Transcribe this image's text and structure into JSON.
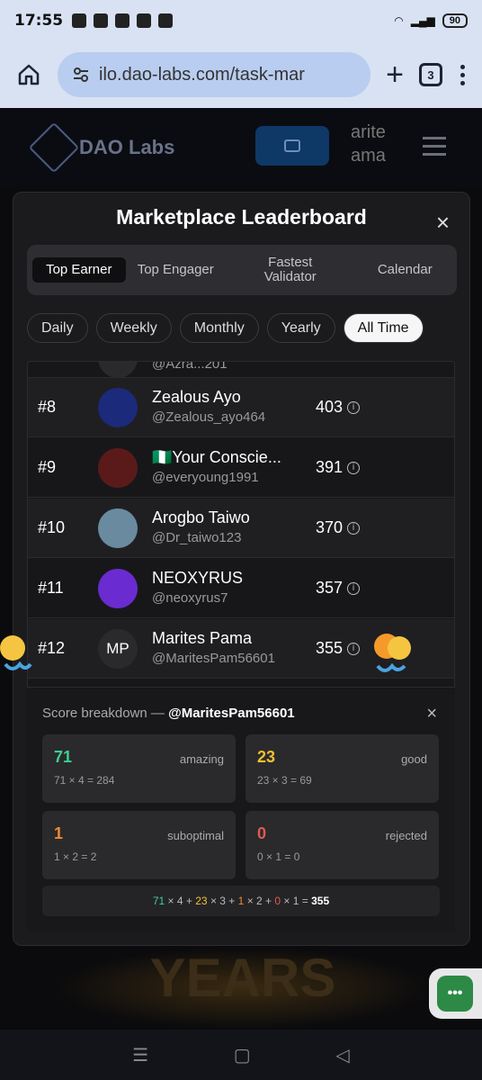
{
  "status_bar": {
    "time": "17:55",
    "battery": "90"
  },
  "browser": {
    "url": "ilo.dao-labs.com/task-mar",
    "tab_count": "3",
    "new_tab": "+"
  },
  "site": {
    "brand": "DAO Labs",
    "user_partial": "arite\nama"
  },
  "modal": {
    "title": "Marketplace Leaderboard",
    "close": "×",
    "tabs": [
      {
        "label": "Top Earner",
        "active": true
      },
      {
        "label": "Top Engager"
      },
      {
        "label": "Fastest Validator"
      },
      {
        "label": "Calendar"
      }
    ],
    "periods": [
      {
        "label": "Daily"
      },
      {
        "label": "Weekly"
      },
      {
        "label": "Monthly"
      },
      {
        "label": "Yearly"
      },
      {
        "label": "All Time",
        "active": true
      }
    ],
    "partial_row_handle": "@Azra...201",
    "rows": [
      {
        "rank": "#8",
        "name": "Zealous Ayo",
        "handle": "@Zealous_ayo464",
        "score": "403",
        "avatar_color": "#1b2a7a"
      },
      {
        "rank": "#9",
        "name": "🇳🇬Your Conscie...",
        "handle": "@everyoung1991",
        "score": "391",
        "avatar_color": "#5a1a1a"
      },
      {
        "rank": "#10",
        "name": "Arogbo Taiwo",
        "handle": "@Dr_taiwo123",
        "score": "370",
        "avatar_color": "#6a8aa0"
      },
      {
        "rank": "#11",
        "name": "NEOXYRUS",
        "handle": "@neoxyrus7",
        "score": "357",
        "avatar_color": "#6a2bd0"
      },
      {
        "rank": "#12",
        "name": "Marites Pama",
        "handle": "@MaritesPam56601",
        "score": "355",
        "avatar_initials": "MP",
        "avatar_color": "#2a2a2d"
      }
    ],
    "breakdown": {
      "title_prefix": "Score breakdown —",
      "handle": "@MaritesPam56601",
      "close": "×",
      "cards": [
        {
          "num": "71",
          "label": "amazing",
          "calc": "71 × 4 = 284",
          "color": "#3ecf8e"
        },
        {
          "num": "23",
          "label": "good",
          "calc": "23 × 3 = 69",
          "color": "#f0c030"
        },
        {
          "num": "1",
          "label": "suboptimal",
          "calc": "1 × 2 = 2",
          "color": "#f08a30"
        },
        {
          "num": "0",
          "label": "rejected",
          "calc": "0 × 1 = 0",
          "color": "#e05a50"
        }
      ],
      "formula": {
        "a": "71",
        "a_mult": "× 4 +",
        "b": "23",
        "b_mult": "× 3 +",
        "c": "1",
        "c_mult": "× 2 +",
        "d": "0",
        "d_mult": "× 1 =",
        "total": "355"
      }
    }
  },
  "background": {
    "anniversary": "YEARS"
  },
  "chat": {
    "label": "•••"
  },
  "nav": {
    "menu": "☰",
    "home": "▢",
    "back": "◁"
  }
}
